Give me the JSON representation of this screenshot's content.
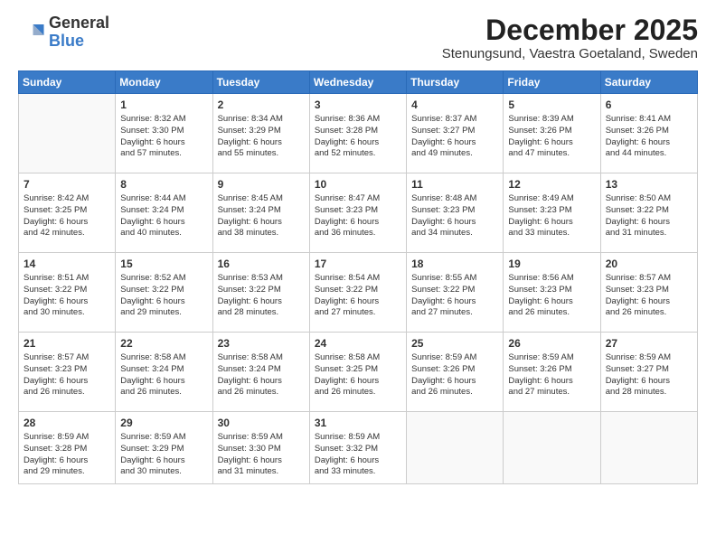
{
  "logo": {
    "general": "General",
    "blue": "Blue"
  },
  "header": {
    "month": "December 2025",
    "location": "Stenungsund, Vaestra Goetaland, Sweden"
  },
  "weekdays": [
    "Sunday",
    "Monday",
    "Tuesday",
    "Wednesday",
    "Thursday",
    "Friday",
    "Saturday"
  ],
  "weeks": [
    [
      {
        "day": "",
        "info": ""
      },
      {
        "day": "1",
        "info": "Sunrise: 8:32 AM\nSunset: 3:30 PM\nDaylight: 6 hours\nand 57 minutes."
      },
      {
        "day": "2",
        "info": "Sunrise: 8:34 AM\nSunset: 3:29 PM\nDaylight: 6 hours\nand 55 minutes."
      },
      {
        "day": "3",
        "info": "Sunrise: 8:36 AM\nSunset: 3:28 PM\nDaylight: 6 hours\nand 52 minutes."
      },
      {
        "day": "4",
        "info": "Sunrise: 8:37 AM\nSunset: 3:27 PM\nDaylight: 6 hours\nand 49 minutes."
      },
      {
        "day": "5",
        "info": "Sunrise: 8:39 AM\nSunset: 3:26 PM\nDaylight: 6 hours\nand 47 minutes."
      },
      {
        "day": "6",
        "info": "Sunrise: 8:41 AM\nSunset: 3:26 PM\nDaylight: 6 hours\nand 44 minutes."
      }
    ],
    [
      {
        "day": "7",
        "info": "Sunrise: 8:42 AM\nSunset: 3:25 PM\nDaylight: 6 hours\nand 42 minutes."
      },
      {
        "day": "8",
        "info": "Sunrise: 8:44 AM\nSunset: 3:24 PM\nDaylight: 6 hours\nand 40 minutes."
      },
      {
        "day": "9",
        "info": "Sunrise: 8:45 AM\nSunset: 3:24 PM\nDaylight: 6 hours\nand 38 minutes."
      },
      {
        "day": "10",
        "info": "Sunrise: 8:47 AM\nSunset: 3:23 PM\nDaylight: 6 hours\nand 36 minutes."
      },
      {
        "day": "11",
        "info": "Sunrise: 8:48 AM\nSunset: 3:23 PM\nDaylight: 6 hours\nand 34 minutes."
      },
      {
        "day": "12",
        "info": "Sunrise: 8:49 AM\nSunset: 3:23 PM\nDaylight: 6 hours\nand 33 minutes."
      },
      {
        "day": "13",
        "info": "Sunrise: 8:50 AM\nSunset: 3:22 PM\nDaylight: 6 hours\nand 31 minutes."
      }
    ],
    [
      {
        "day": "14",
        "info": "Sunrise: 8:51 AM\nSunset: 3:22 PM\nDaylight: 6 hours\nand 30 minutes."
      },
      {
        "day": "15",
        "info": "Sunrise: 8:52 AM\nSunset: 3:22 PM\nDaylight: 6 hours\nand 29 minutes."
      },
      {
        "day": "16",
        "info": "Sunrise: 8:53 AM\nSunset: 3:22 PM\nDaylight: 6 hours\nand 28 minutes."
      },
      {
        "day": "17",
        "info": "Sunrise: 8:54 AM\nSunset: 3:22 PM\nDaylight: 6 hours\nand 27 minutes."
      },
      {
        "day": "18",
        "info": "Sunrise: 8:55 AM\nSunset: 3:22 PM\nDaylight: 6 hours\nand 27 minutes."
      },
      {
        "day": "19",
        "info": "Sunrise: 8:56 AM\nSunset: 3:23 PM\nDaylight: 6 hours\nand 26 minutes."
      },
      {
        "day": "20",
        "info": "Sunrise: 8:57 AM\nSunset: 3:23 PM\nDaylight: 6 hours\nand 26 minutes."
      }
    ],
    [
      {
        "day": "21",
        "info": "Sunrise: 8:57 AM\nSunset: 3:23 PM\nDaylight: 6 hours\nand 26 minutes."
      },
      {
        "day": "22",
        "info": "Sunrise: 8:58 AM\nSunset: 3:24 PM\nDaylight: 6 hours\nand 26 minutes."
      },
      {
        "day": "23",
        "info": "Sunrise: 8:58 AM\nSunset: 3:24 PM\nDaylight: 6 hours\nand 26 minutes."
      },
      {
        "day": "24",
        "info": "Sunrise: 8:58 AM\nSunset: 3:25 PM\nDaylight: 6 hours\nand 26 minutes."
      },
      {
        "day": "25",
        "info": "Sunrise: 8:59 AM\nSunset: 3:26 PM\nDaylight: 6 hours\nand 26 minutes."
      },
      {
        "day": "26",
        "info": "Sunrise: 8:59 AM\nSunset: 3:26 PM\nDaylight: 6 hours\nand 27 minutes."
      },
      {
        "day": "27",
        "info": "Sunrise: 8:59 AM\nSunset: 3:27 PM\nDaylight: 6 hours\nand 28 minutes."
      }
    ],
    [
      {
        "day": "28",
        "info": "Sunrise: 8:59 AM\nSunset: 3:28 PM\nDaylight: 6 hours\nand 29 minutes."
      },
      {
        "day": "29",
        "info": "Sunrise: 8:59 AM\nSunset: 3:29 PM\nDaylight: 6 hours\nand 30 minutes."
      },
      {
        "day": "30",
        "info": "Sunrise: 8:59 AM\nSunset: 3:30 PM\nDaylight: 6 hours\nand 31 minutes."
      },
      {
        "day": "31",
        "info": "Sunrise: 8:59 AM\nSunset: 3:32 PM\nDaylight: 6 hours\nand 33 minutes."
      },
      {
        "day": "",
        "info": ""
      },
      {
        "day": "",
        "info": ""
      },
      {
        "day": "",
        "info": ""
      }
    ]
  ]
}
